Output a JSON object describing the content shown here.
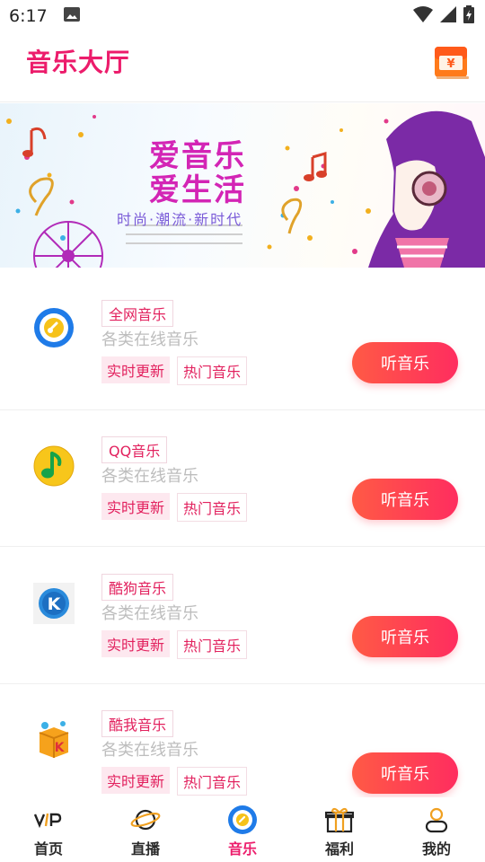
{
  "status_bar": {
    "time": "6:17"
  },
  "header": {
    "title": "音乐大厅",
    "wallet_symbol": "¥"
  },
  "banner": {
    "line1": "爱音乐",
    "line2": "爱生活",
    "slogan": "时尚·潮流·新时代"
  },
  "items": [
    {
      "name": "全网音乐",
      "desc": "各类在线音乐",
      "tag1": "实时更新",
      "tag2": "热门音乐",
      "button": "听音乐",
      "icon": "quanwang-music-logo-icon"
    },
    {
      "name": "QQ音乐",
      "desc": "各类在线音乐",
      "tag1": "实时更新",
      "tag2": "热门音乐",
      "button": "听音乐",
      "icon": "qq-music-logo-icon"
    },
    {
      "name": "酷狗音乐",
      "desc": "各类在线音乐",
      "tag1": "实时更新",
      "tag2": "热门音乐",
      "button": "听音乐",
      "icon": "kugou-music-logo-icon"
    },
    {
      "name": "酷我音乐",
      "desc": "各类在线音乐",
      "tag1": "实时更新",
      "tag2": "热门音乐",
      "button": "听音乐",
      "icon": "kuwo-music-logo-icon"
    }
  ],
  "tabs": [
    {
      "label": "首页",
      "icon": "vip-icon",
      "active": false
    },
    {
      "label": "直播",
      "icon": "planet-icon",
      "active": false
    },
    {
      "label": "音乐",
      "icon": "music-disc-icon",
      "active": true
    },
    {
      "label": "福利",
      "icon": "gift-icon",
      "active": false
    },
    {
      "label": "我的",
      "icon": "user-icon",
      "active": false
    }
  ],
  "colors": {
    "brand": "#ec1c6b",
    "button_start": "#ff5a45",
    "button_end": "#ff2d5f"
  }
}
